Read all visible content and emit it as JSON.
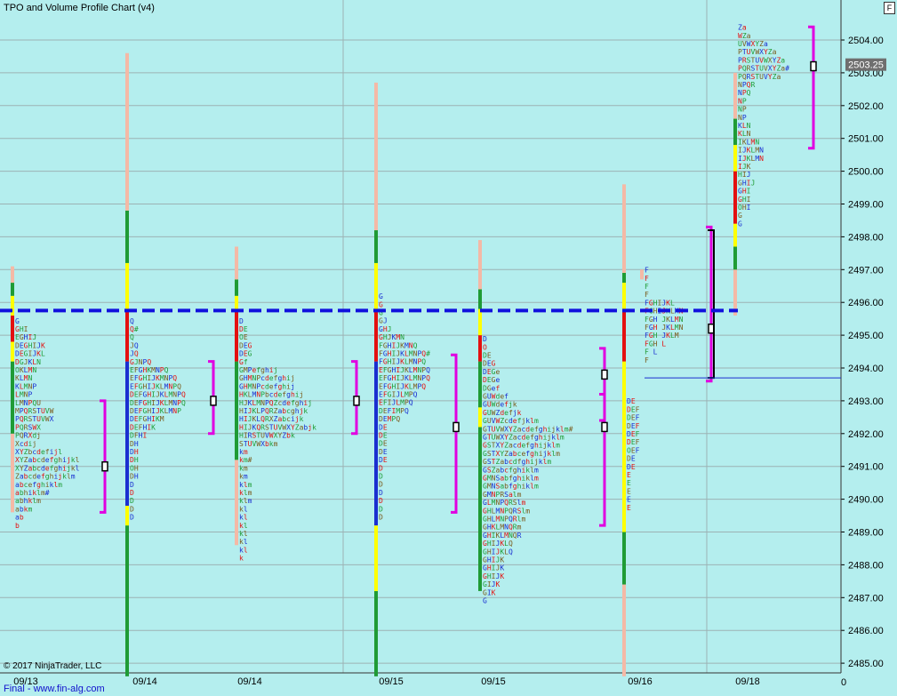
{
  "header": {
    "title": "TPO and Volume Profile Chart (v4)",
    "corner_button": "F"
  },
  "footer": {
    "copyright": "© 2017 NinjaTrader, LLC",
    "link": "Final - www.fin-alg.com"
  },
  "axis": {
    "corner_value": "0"
  },
  "colors": {
    "background": "#b4eeee",
    "grid": "#9cb2b4",
    "poc_dashed": "#1111dd",
    "value_area": "#e000e0",
    "bar_red": "#e31010",
    "bar_green": "#1f9b35",
    "bar_yellow": "#ffff00",
    "bar_blue": "#1a2fd0",
    "bar_pink": "#f4b9a6"
  },
  "chart_data": {
    "type": "market_profile",
    "x": {
      "ticks": [
        "09/13",
        "09/14",
        "09/14",
        "09/15",
        "09/15",
        "09/16",
        "09/18"
      ]
    },
    "y": {
      "min": 2484.8,
      "max": 2505.2,
      "ticks": [
        "2504.00",
        "2503.00",
        "2502.00",
        "2501.00",
        "2500.00",
        "2499.00",
        "2498.00",
        "2497.00",
        "2496.00",
        "2495.00",
        "2494.00",
        "2493.00",
        "2492.00",
        "2491.00",
        "2490.00",
        "2489.00",
        "2488.00",
        "2487.00",
        "2486.00",
        "2485.00"
      ],
      "current_price": "2503.25"
    },
    "poc_line": 2495.75,
    "sessions": [
      {
        "bar": {
          "low": 2489.6,
          "high": 2497.1,
          "segments": [
            [
              2489.6,
              2492.0,
              "pink"
            ],
            [
              2492.0,
              2494.2,
              "green"
            ],
            [
              2494.2,
              2494.8,
              "yellow"
            ],
            [
              2494.8,
              2495.6,
              "red"
            ],
            [
              2495.6,
              2496.2,
              "yellow"
            ],
            [
              2496.2,
              2496.6,
              "green"
            ],
            [
              2496.6,
              2497.1,
              "pink"
            ]
          ]
        },
        "va": {
          "low": 2489.6,
          "high": 2493.0
        },
        "poc": 2491.0,
        "tpo_top": 2495.55,
        "tpo": [
          "G",
          "GHI",
          "EGHIJ",
          "DEGHIJK",
          "DEGIJKL",
          "DGJKLN",
          "OKLMN",
          "KLMN",
          "KLMNP",
          "LMNP",
          "LMNPQU",
          "MPQRSTUVW",
          "PQRSTUVWX",
          "PQRSWX",
          "PQRXdj",
          "Xcdij",
          "XYZbcdefijl",
          "XYZabcdefghijkl",
          "XYZabcdefghijkl",
          "Zabcdefghijklm",
          "abcefghiklm",
          "abhiklm#",
          "abhklm",
          "abkm",
          "ab",
          "b"
        ]
      },
      {
        "bar": {
          "low": 2484.6,
          "high": 2503.6,
          "segments": [
            [
              2484.6,
              2489.2,
              "green"
            ],
            [
              2489.2,
              2489.8,
              "yellow"
            ],
            [
              2489.8,
              2494.2,
              "blue"
            ],
            [
              2494.2,
              2495.8,
              "red"
            ],
            [
              2495.8,
              2497.2,
              "yellow"
            ],
            [
              2497.2,
              2498.8,
              "green"
            ],
            [
              2498.8,
              2503.6,
              "pink"
            ]
          ]
        },
        "va": {
          "low": 2492.0,
          "high": 2494.2
        },
        "poc": 2493.0,
        "tpo_top": 2495.55,
        "tpo": [
          "Q",
          "Q#",
          "Q",
          "JQ",
          "JQ",
          "GJNPQ",
          "EFGHKMNPQ",
          "EFGHIJKMNPQ",
          "EFGHIJKLMNPQ",
          "DEFGHIJKLMNPQ",
          "DEFGHIJKLMNPQ",
          "DEFGHIJKLMNP",
          "DEFGHIKM",
          "DEFHIK",
          "DFHI",
          "DH",
          "DH",
          "DH",
          "OH",
          "DH",
          "D",
          "D",
          "D",
          "D",
          "D"
        ]
      },
      {
        "bar": {
          "low": 2488.6,
          "high": 2497.7,
          "segments": [
            [
              2488.6,
              2491.2,
              "pink"
            ],
            [
              2491.2,
              2494.2,
              "green"
            ],
            [
              2494.2,
              2495.8,
              "red"
            ],
            [
              2495.8,
              2496.2,
              "yellow"
            ],
            [
              2496.2,
              2496.7,
              "green"
            ],
            [
              2496.7,
              2497.7,
              "pink"
            ]
          ]
        },
        "va": {
          "low": 2492.0,
          "high": 2494.2
        },
        "poc": 2493.0,
        "tpo_top": 2495.55,
        "tpo": [
          "D",
          "DE",
          "OE",
          "DEG",
          "DEG",
          "Gf",
          "GMPefghij",
          "GHMNPcdefghij",
          "GHMNPcdefghij",
          "HKLMNPbcdefghij",
          "HJKLMNPQZcdefghij",
          "HIJKLPQRZabcghjk",
          "HIJKLQRXZabcijk",
          "HIJKQRSTUVWXYZabjk",
          "HIRSTUVWXYZbk",
          "STUVWXbkm",
          "km",
          "km#",
          "km",
          "km",
          "klm",
          "klm",
          "klm",
          "kl",
          "kl",
          "kl",
          "kl",
          "kl",
          "kl",
          "k"
        ]
      },
      {
        "bar": {
          "low": 2484.6,
          "high": 2502.7,
          "segments": [
            [
              2484.6,
              2487.2,
              "green"
            ],
            [
              2487.2,
              2489.2,
              "yellow"
            ],
            [
              2489.2,
              2494.2,
              "blue"
            ],
            [
              2494.2,
              2495.8,
              "red"
            ],
            [
              2495.8,
              2497.2,
              "yellow"
            ],
            [
              2497.2,
              2498.2,
              "green"
            ],
            [
              2498.2,
              2502.7,
              "pink"
            ]
          ]
        },
        "va": {
          "low": 2489.6,
          "high": 2494.4
        },
        "poc": 2492.2,
        "tpo_top": 2496.3,
        "tpo": [
          "G",
          "G",
          "G",
          "GJ",
          "GHJ",
          "GHJKMN",
          "FGHIJKMNQ",
          "FGHIJKLMNPQ#",
          "FGHIJKLMNPQ",
          "EFGHIJKLMNPQ",
          "EFGHIJKLMNPQ",
          "EFGHIJKLMPQ",
          "EFGIJLMPQ",
          "EFIJLMPQ",
          "DEFIMPQ",
          "DEMPQ",
          "DE",
          "DE",
          "DE",
          "DE",
          "DE",
          "D",
          "D",
          "D",
          "D",
          "D",
          "D",
          "D"
        ]
      },
      {
        "bar": {
          "low": 2487.2,
          "high": 2497.9,
          "segments": [
            [
              2487.2,
              2492.2,
              "green"
            ],
            [
              2492.2,
              2492.8,
              "yellow"
            ],
            [
              2492.8,
              2494.2,
              "green"
            ],
            [
              2494.2,
              2495.0,
              "red"
            ],
            [
              2495.0,
              2495.8,
              "yellow"
            ],
            [
              2495.8,
              2496.4,
              "green"
            ],
            [
              2496.4,
              2497.9,
              "pink"
            ]
          ]
        },
        "va": {
          "low": 2492.4,
          "high": 2494.6
        },
        "poc": 2493.8,
        "tpo_top": 2495.0,
        "tpo": [
          "D",
          "O",
          "DE",
          "DEG",
          "DEGe",
          "DEGe",
          "DGef",
          "GUWdef",
          "GUWdefjk",
          "GUWZdefjk",
          "GUVWZcdefjklm",
          "GTUVWXYZacdefghijklm#",
          "GTUWXYZacdefghijklm",
          "GSTXYZacdefghijklm",
          "GSTXYZabcefghijklm",
          "GSTZabcdfghijklm",
          "GSZabcfghiklm",
          "GMNSabfghiklm",
          "GMNSabfghiklm",
          "GMNPRSalm",
          "GLMNPQRSlm",
          "GHLMNPQRSlm",
          "GHLMNPQRlm",
          "GHKLMNQRm",
          "GHIKLMNQR",
          "GHIJKLQ",
          "GHIJKLQ",
          "GHIJK",
          "GHIJK",
          "GHIJK",
          "GIJK",
          "GIK",
          "G"
        ]
      },
      {
        "bar": {
          "low": 2484.6,
          "high": 2499.6,
          "segments": [
            [
              2484.6,
              2487.4,
              "pink"
            ],
            [
              2487.4,
              2489.0,
              "green"
            ],
            [
              2489.0,
              2494.2,
              "yellow"
            ],
            [
              2494.2,
              2495.8,
              "red"
            ],
            [
              2495.8,
              2496.6,
              "yellow"
            ],
            [
              2496.6,
              2496.9,
              "green"
            ],
            [
              2496.9,
              2499.6,
              "pink"
            ]
          ]
        },
        "va": {
          "low": 2489.2,
          "high": 2493.2
        },
        "poc": 2492.2,
        "tpo_top": 2493.1,
        "tpo": [
          "DE",
          "DEF",
          "DEF",
          "DEF",
          "DEF",
          "DEF",
          "OEF",
          "DE",
          "DE",
          "E",
          "E",
          "E",
          "E",
          "E"
        ]
      },
      {
        "bar": {
          "low": 2496.7,
          "high": 2497.0,
          "segments": [
            [
              2496.7,
              2497.0,
              "pink"
            ]
          ]
        },
        "va": {
          "low": 2493.6,
          "high": 2498.3
        },
        "poc": 2495.2,
        "tpo_top": 2497.1,
        "tpo": [
          "F",
          "F",
          "F",
          "F",
          "FGHIJKL",
          "FGHIJKLMN",
          "FGH JKLMN",
          "FGH JKLMN",
          "FGH JKLM",
          "FGH L",
          "F L",
          "F"
        ]
      },
      {
        "bar": {
          "low": 2495.6,
          "high": 2503.0,
          "segments": [
            [
              2495.6,
              2497.0,
              "pink"
            ],
            [
              2497.0,
              2497.7,
              "green"
            ],
            [
              2497.7,
              2498.4,
              "yellow"
            ],
            [
              2498.4,
              2500.0,
              "red"
            ],
            [
              2500.0,
              2500.8,
              "yellow"
            ],
            [
              2500.8,
              2501.6,
              "green"
            ],
            [
              2501.6,
              2503.0,
              "pink"
            ]
          ]
        },
        "va": {
          "low": 2500.7,
          "high": 2504.4
        },
        "poc": 2503.2,
        "tpo_top": 2504.5,
        "tpo": [
          "Za",
          "WZa",
          "UVWXYZa",
          "PTUVWXYZa",
          "PRSTUVWXYZa",
          "PQRSTUVXYZa#",
          "PQRSTUVYZa",
          "NPQR",
          "NPQ",
          "NP",
          "NP",
          "NP",
          "KLN",
          "KLN",
          "IKLMN",
          "IJKLMN",
          "IJKLMN",
          "IJK",
          "HIJ",
          "GHIJ",
          "GHI",
          "GHI",
          "OHI",
          "G",
          "G"
        ]
      }
    ]
  }
}
